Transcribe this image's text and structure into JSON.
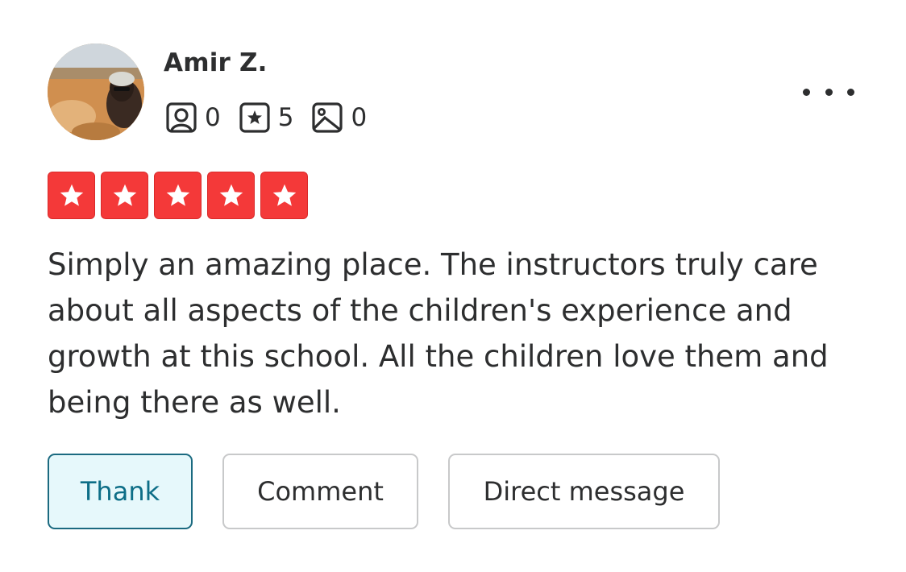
{
  "review": {
    "user": {
      "name": "Amir Z.",
      "avatar_icon": "user-photo-avatar"
    },
    "stats": {
      "friends": {
        "icon": "friends-icon",
        "count": "0"
      },
      "reviews": {
        "icon": "review-star-icon",
        "count": "5"
      },
      "photos": {
        "icon": "photo-icon",
        "count": "0"
      }
    },
    "more_icon": "more-options-icon",
    "rating": {
      "value": 5,
      "max": 5,
      "star_color": "#f43939"
    },
    "text": "Simply an amazing place. The instructors truly care about all aspects of the children's experience and growth at this school. All the children love them and being there as well."
  },
  "actions": {
    "thank_label": "Thank",
    "comment_label": "Comment",
    "direct_message_label": "Direct message"
  },
  "colors": {
    "thank_bg": "#e6f8fb",
    "thank_border": "#1b6a80",
    "text": "#2d2e2f"
  }
}
